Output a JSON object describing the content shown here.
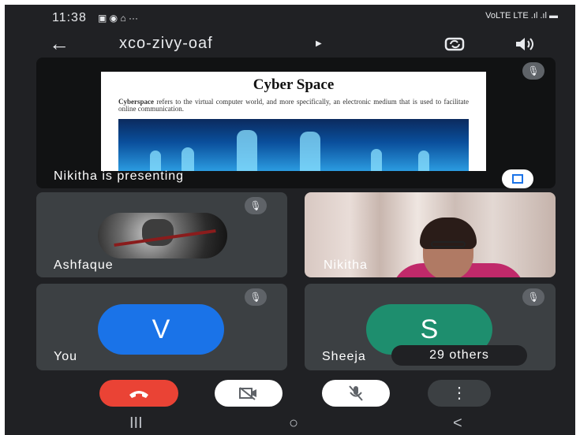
{
  "status_bar": {
    "time": "11:38",
    "notification_icons": "▣ ◉ ⌂ ···",
    "signal": "VoLTE LTE .ıl .ıl ▬"
  },
  "header": {
    "meeting_code": "xco-zivy-oaf"
  },
  "presentation": {
    "slide_title": "Cyber Space",
    "slide_text_bold": "Cyberspace",
    "slide_text": " refers to the virtual computer world, and more specifically, an electronic medium that is used to facilitate online communication.",
    "label": "Nikitha is presenting"
  },
  "participants": [
    {
      "name": "Ashfaque",
      "type": "photo"
    },
    {
      "name": "Nikitha",
      "type": "camera"
    },
    {
      "name": "You",
      "initial": "V",
      "color": "#1a73e8"
    },
    {
      "name": "Sheeja",
      "initial": "S",
      "color": "#1e8e6e"
    }
  ],
  "others_label": "29 others",
  "colors": {
    "end_call": "#ea4335",
    "background": "#202124",
    "tile": "#3c4043"
  }
}
